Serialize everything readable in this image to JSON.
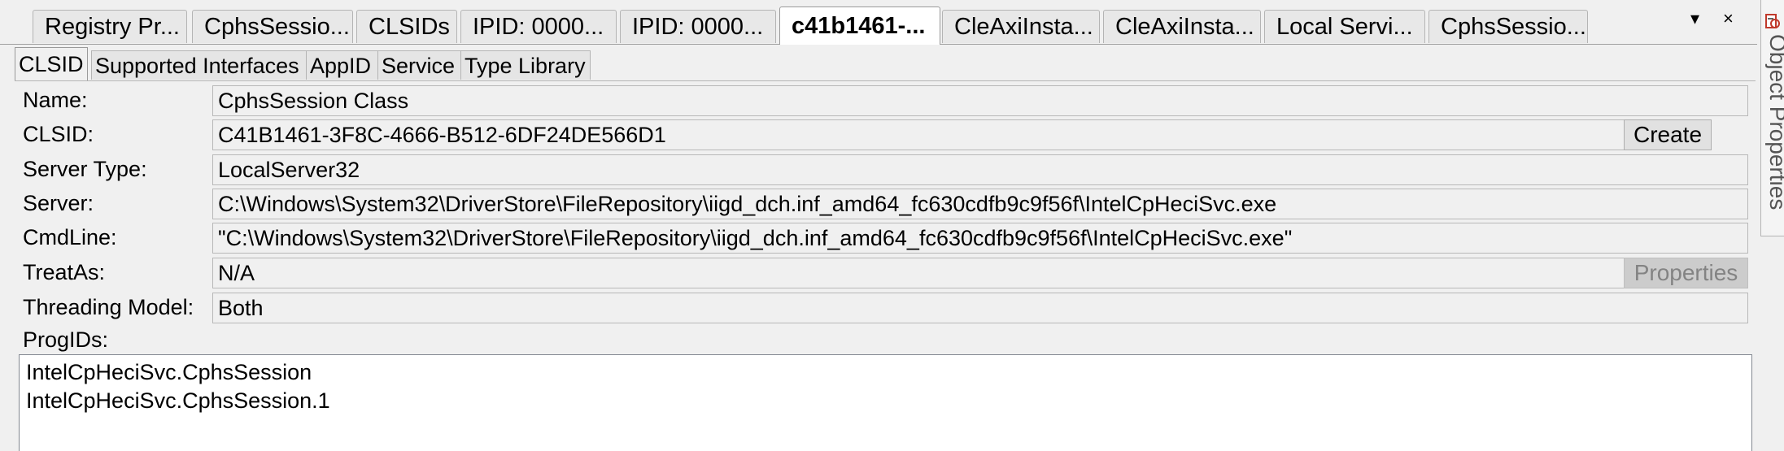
{
  "doc_tabs": [
    {
      "label": "Registry Pr...",
      "active": false
    },
    {
      "label": "CphsSessio...",
      "active": false
    },
    {
      "label": "CLSIDs",
      "active": false
    },
    {
      "label": "IPID: 0000...",
      "active": false
    },
    {
      "label": "IPID: 0000...",
      "active": false
    },
    {
      "label": "c41b1461-...",
      "active": true
    },
    {
      "label": "CleAxiInsta...",
      "active": false
    },
    {
      "label": "CleAxiInsta...",
      "active": false
    },
    {
      "label": "Local Servi...",
      "active": false
    },
    {
      "label": "CphsSessio...",
      "active": false
    }
  ],
  "strip_controls": {
    "dropdown": "▾",
    "close": "×"
  },
  "side_panel": {
    "label": "Object Properties",
    "icon": "properties-icon"
  },
  "sub_tabs": [
    {
      "label": "CLSID",
      "active": true
    },
    {
      "label": "Supported Interfaces",
      "active": false
    },
    {
      "label": "AppID",
      "active": false
    },
    {
      "label": "Service",
      "active": false
    },
    {
      "label": "Type Library",
      "active": false
    }
  ],
  "form": {
    "name_label": "Name:",
    "name_value": "CphsSession Class",
    "clsid_label": "CLSID:",
    "clsid_value": "C41B1461-3F8C-4666-B512-6DF24DE566D1",
    "create_button": "Create",
    "server_type_label": "Server Type:",
    "server_type_value": "LocalServer32",
    "server_label": "Server:",
    "server_value": "C:\\Windows\\System32\\DriverStore\\FileRepository\\iigd_dch.inf_amd64_fc630cdfb9c9f56f\\IntelCpHeciSvc.exe",
    "cmdline_label": "CmdLine:",
    "cmdline_value": "\"C:\\Windows\\System32\\DriverStore\\FileRepository\\iigd_dch.inf_amd64_fc630cdfb9c9f56f\\IntelCpHeciSvc.exe\"",
    "treatas_label": "TreatAs:",
    "treatas_value": "N/A",
    "properties_button": "Properties",
    "threading_label": "Threading Model:",
    "threading_value": "Both",
    "progids_label": "ProgIDs:",
    "progids": [
      "IntelCpHeciSvc.CphsSession",
      "IntelCpHeciSvc.CphsSession.1"
    ]
  }
}
